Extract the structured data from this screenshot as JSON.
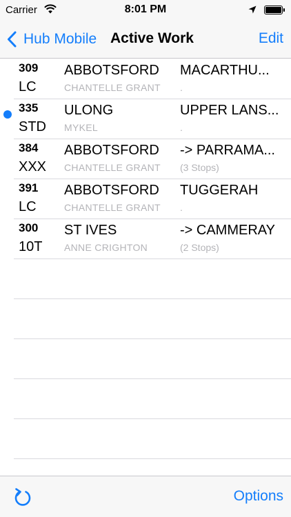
{
  "status_bar": {
    "carrier": "Carrier",
    "time": "8:01 PM",
    "icons": [
      "wifi-icon",
      "location-icon",
      "battery-icon"
    ]
  },
  "nav": {
    "back_label": "Hub Mobile",
    "title": "Active Work",
    "edit_label": "Edit"
  },
  "rows": [
    {
      "number": "309",
      "code": "LC",
      "origin": "ABBOTSFORD",
      "driver": "CHANTELLE GRANT",
      "destination": "MACARTHU...",
      "stops": ".",
      "unread": false
    },
    {
      "number": "335",
      "code": "STD",
      "origin": "ULONG",
      "driver": "MYKEL",
      "destination": "UPPER LANS...",
      "stops": ".",
      "unread": true
    },
    {
      "number": "384",
      "code": "XXX",
      "origin": "ABBOTSFORD",
      "driver": "CHANTELLE GRANT",
      "destination": "-> PARRAMA...",
      "stops": "(3 Stops)",
      "unread": false
    },
    {
      "number": "391",
      "code": "LC",
      "origin": "ABBOTSFORD",
      "driver": "CHANTELLE GRANT",
      "destination": "TUGGERAH",
      "stops": ".",
      "unread": false
    },
    {
      "number": "300",
      "code": "10T",
      "origin": "ST IVES",
      "driver": "ANNE CRIGHTON",
      "destination": "-> CAMMERAY",
      "stops": "(2 Stops)",
      "unread": false
    }
  ],
  "toolbar": {
    "refresh_icon": "refresh-icon",
    "options_label": "Options"
  },
  "colors": {
    "accent": "#147efb",
    "unread_dot": "#147efb",
    "secondary_text": "#b4b4b8"
  }
}
